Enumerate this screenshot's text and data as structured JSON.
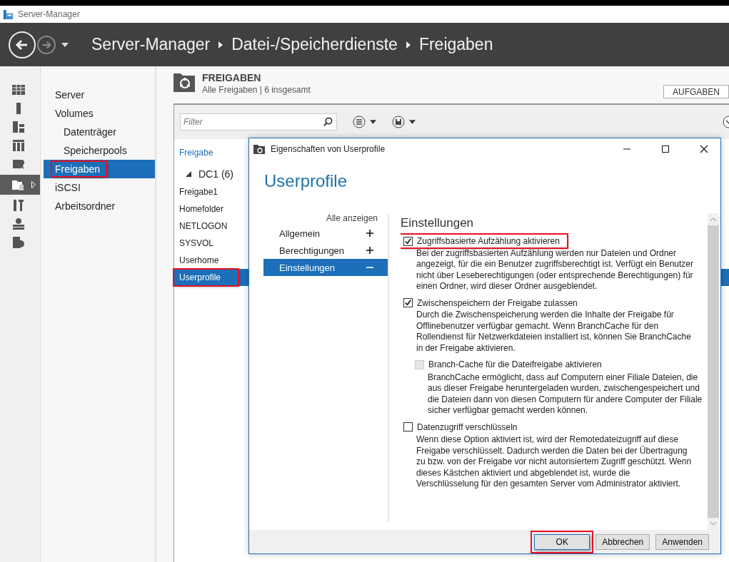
{
  "app_title": "Server-Manager",
  "breadcrumb": [
    "Server-Manager",
    "Datei-/Speicherdienste",
    "Freigaben"
  ],
  "rail": [
    {
      "selected": false
    },
    {
      "selected": false
    },
    {
      "selected": false
    },
    {
      "selected": false
    },
    {
      "selected": false
    },
    {
      "selected": true
    },
    {
      "selected": false
    },
    {
      "selected": false
    },
    {
      "selected": false
    }
  ],
  "nav": [
    {
      "label": "Server",
      "selected": false,
      "highlighted": false
    },
    {
      "label": "Volumes",
      "selected": false,
      "highlighted": false,
      "children": [
        {
          "label": "Datenträger",
          "selected": false,
          "highlighted": false
        },
        {
          "label": "Speicherpools",
          "selected": false,
          "highlighted": false
        }
      ]
    },
    {
      "label": "Freigaben",
      "selected": true,
      "highlighted": true
    },
    {
      "label": "iSCSI",
      "selected": false,
      "highlighted": false
    },
    {
      "label": "Arbeitsordner",
      "selected": false,
      "highlighted": false
    }
  ],
  "section": {
    "title": "FREIGABEN",
    "subtitle": "Alle Freigaben | 6 insgesamt",
    "tasks_button": "AUFGABEN"
  },
  "filter": {
    "placeholder": "Filter"
  },
  "shares": {
    "column": "Freigabe",
    "groups": [
      {
        "label": "DC1 (6)",
        "expanded": true,
        "children": [
          {
            "label": "Freigabe1",
            "selected": false,
            "highlighted": false
          },
          {
            "label": "Homefolder",
            "selected": false,
            "highlighted": false
          },
          {
            "label": "NETLOGON",
            "selected": false,
            "highlighted": false
          },
          {
            "label": "SYSVOL",
            "selected": false,
            "highlighted": false
          },
          {
            "label": "Userhome",
            "selected": false,
            "highlighted": false
          },
          {
            "label": "Userprofile",
            "selected": true,
            "highlighted": true
          }
        ]
      }
    ]
  },
  "dialog": {
    "title": "Eigenschaften von Userprofile",
    "heading": "Userprofile",
    "show_all": "Alle anzeigen",
    "sections": [
      {
        "label": "Allgemein",
        "expanded": false,
        "selected": false
      },
      {
        "label": "Berechtigungen",
        "expanded": false,
        "selected": false
      },
      {
        "label": "Einstellungen",
        "expanded": true,
        "selected": true
      }
    ],
    "content_title": "Einstellungen",
    "options": [
      {
        "label": "Zugriffsbasierte Aufzählung aktivieren",
        "checked": true,
        "disabled": false,
        "highlighted": true,
        "description": "Bei der zugriffsbasierten Aufzählung werden nur Dateien und Ordner angezeigt, für die ein Benutzer zugriffsberechtigt ist. Verfügt ein Benutzer nicht über Leseberechtigungen (oder entsprechende Berechtigungen) für einen Ordner, wird dieser Ordner ausgeblendet."
      },
      {
        "label": "Zwischenspeichern der Freigabe zulassen",
        "checked": true,
        "disabled": false,
        "highlighted": false,
        "description": "Durch die Zwischenspeicherung werden die Inhalte der Freigabe für Offlinebenutzer verfügbar gemacht. Wenn BranchCache für den Rollendienst für Netzwerkdateien installiert ist, können Sie BranchCache in der Freigabe aktivieren.",
        "children": [
          {
            "label": "Branch-Cache für die Dateifreigabe aktivieren",
            "checked": false,
            "disabled": true,
            "highlighted": false,
            "description": "BranchCache ermöglicht, dass auf Computern einer Filiale Dateien, die aus dieser Freigabe heruntergeladen wurden, zwischengespeichert und die Dateien dann von diesen Computern für andere Computer der Filiale sicher verfügbar gemacht werden können."
          }
        ]
      },
      {
        "label": "Datenzugriff verschlüsseln",
        "checked": false,
        "disabled": false,
        "highlighted": false,
        "description": "Wenn diese Option aktiviert ist, wird der Remotedateizugriff auf diese Freigabe verschlüsselt. Dadurch werden die Daten bei der Übertragung zu bzw. von der Freigabe vor nicht autorisiertem Zugriff geschützt. Wenn dieses Kästchen aktiviert und abgeblendet ist, wurde die Verschlüsselung für den gesamten Server vom Administrator aktiviert."
      }
    ],
    "buttons": [
      {
        "label": "OK",
        "default": true,
        "highlighted": true
      },
      {
        "label": "Abbrechen",
        "default": false,
        "highlighted": false
      },
      {
        "label": "Anwenden",
        "default": false,
        "highlighted": false
      }
    ]
  }
}
